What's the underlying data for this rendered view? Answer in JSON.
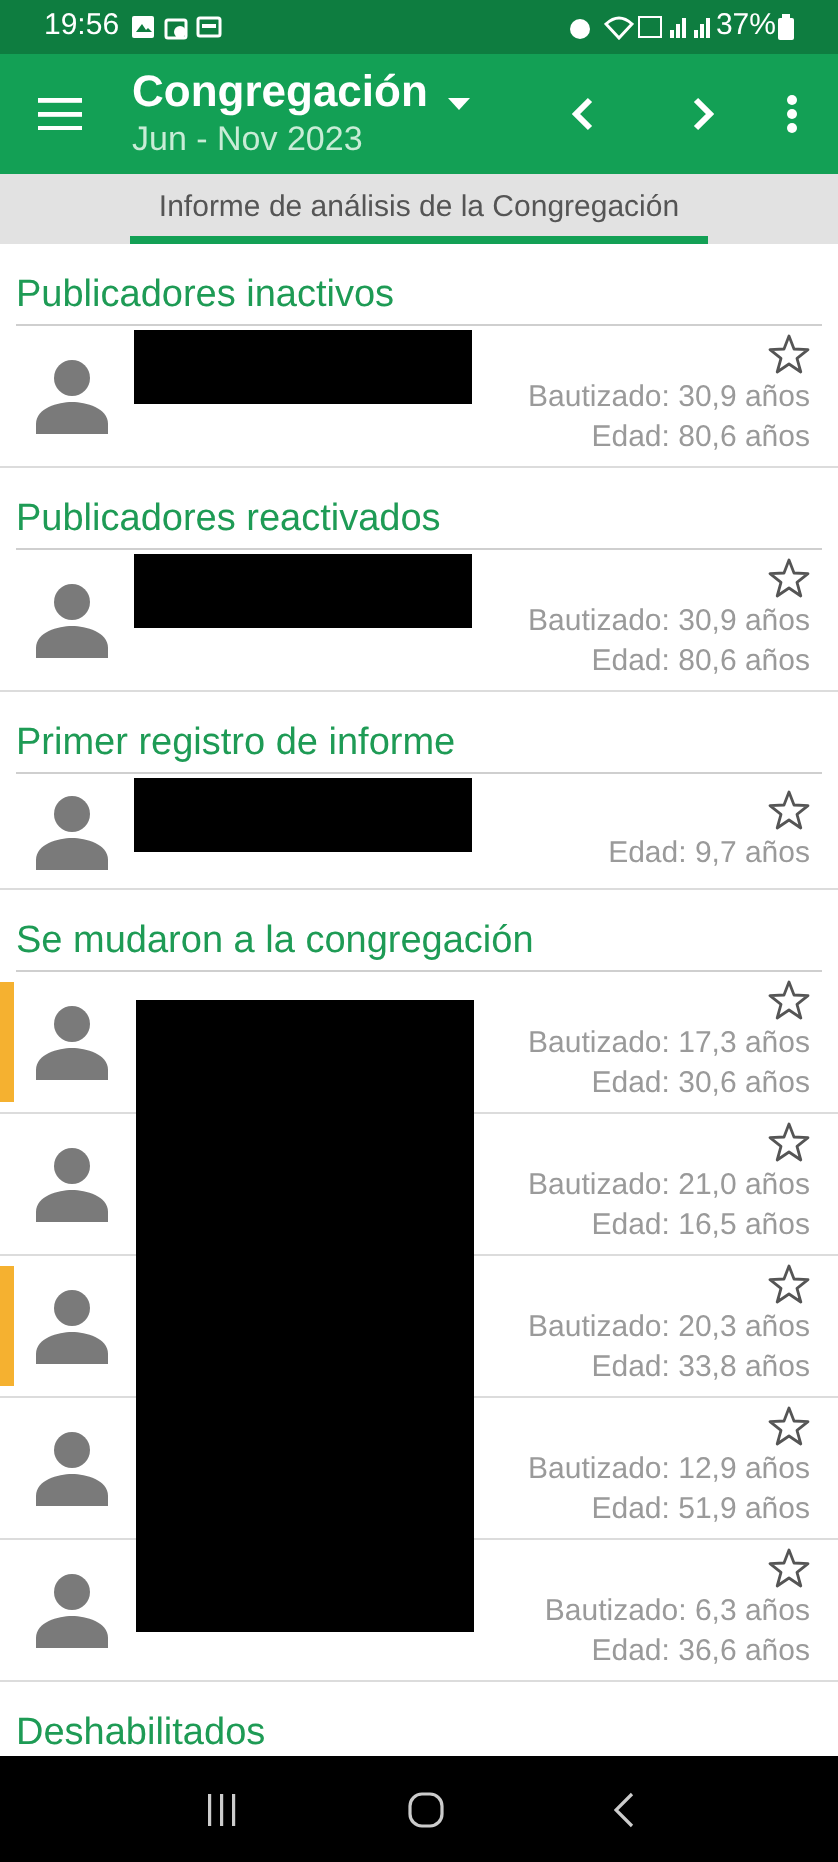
{
  "status_bar": {
    "time": "19:56",
    "battery": "37%"
  },
  "app_bar": {
    "title": "Congregación",
    "subtitle": "Jun - Nov 2023"
  },
  "tabs": [
    {
      "label": "Informe de análisis de la Congregación",
      "selected": true
    }
  ],
  "sections": [
    {
      "title": "Publicadores inactivos",
      "redacted": true,
      "people": [
        {
          "lines": [
            "Bautizado: 30,9 años",
            "Edad: 80,6 años"
          ],
          "starred": false,
          "flagged": false
        }
      ]
    },
    {
      "title": "Publicadores reactivados",
      "redacted": true,
      "people": [
        {
          "lines": [
            "Bautizado: 30,9 años",
            "Edad: 80,6 años"
          ],
          "starred": false,
          "flagged": false
        }
      ]
    },
    {
      "title": "Primer registro de informe",
      "redacted": true,
      "people": [
        {
          "lines": [
            "Edad: 9,7 años"
          ],
          "starred": false,
          "flagged": false
        }
      ]
    },
    {
      "title": "Se mudaron a la congregación",
      "redacted": true,
      "people": [
        {
          "lines": [
            "Bautizado: 17,3 años",
            "Edad: 30,6 años"
          ],
          "starred": false,
          "flagged": true
        },
        {
          "lines": [
            "Bautizado: 21,0 años",
            "Edad: 16,5 años"
          ],
          "starred": false,
          "flagged": false
        },
        {
          "lines": [
            "Bautizado: 20,3 años",
            "Edad: 33,8 años"
          ],
          "starred": false,
          "flagged": true
        },
        {
          "lines": [
            "Bautizado: 12,9 años",
            "Edad: 51,9 años"
          ],
          "starred": false,
          "flagged": false
        },
        {
          "lines": [
            "Bautizado: 6,3 años",
            "Edad: 36,6 años"
          ],
          "starred": false,
          "flagged": false
        }
      ]
    },
    {
      "title": "Deshabilitados"
    }
  ]
}
